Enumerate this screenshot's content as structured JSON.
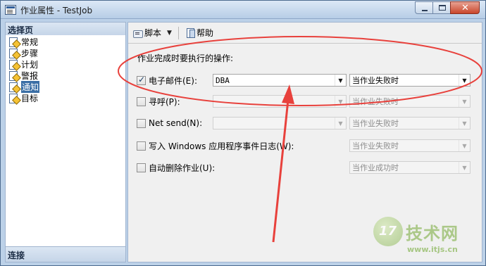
{
  "window": {
    "title": "作业属性 - TestJob",
    "minimize_glyph": "",
    "close_glyph": "✕"
  },
  "left_pane": {
    "header": "选择页",
    "items": [
      {
        "label": "常规",
        "selected": false
      },
      {
        "label": "步骤",
        "selected": false
      },
      {
        "label": "计划",
        "selected": false
      },
      {
        "label": "警报",
        "selected": false
      },
      {
        "label": "通知",
        "selected": true
      },
      {
        "label": "目标",
        "selected": false
      }
    ],
    "footer": "连接"
  },
  "toolbar": {
    "script_label": "脚本",
    "script_caret": "▼",
    "help_label": "帮助"
  },
  "notifications": {
    "section_label": "作业完成时要执行的操作:",
    "rows": [
      {
        "label": "电子邮件(E):",
        "checked": true,
        "target": "DBA",
        "target_enabled": true,
        "condition": "当作业失败时",
        "condition_enabled": true
      },
      {
        "label": "寻呼(P):",
        "checked": false,
        "target": "",
        "target_enabled": false,
        "condition": "当作业失败时",
        "condition_enabled": false
      },
      {
        "label": "Net send(N):",
        "checked": false,
        "target": "",
        "target_enabled": false,
        "condition": "当作业失败时",
        "condition_enabled": false
      },
      {
        "label": "写入 Windows 应用程序事件日志(W):",
        "checked": false,
        "condition": "当作业失败时",
        "condition_enabled": false
      },
      {
        "label": "自动删除作业(U):",
        "checked": false,
        "condition": "当作业成功时",
        "condition_enabled": false
      }
    ],
    "combo_arrow": "▼"
  },
  "annotation": {
    "color": "#e8413c"
  },
  "watermark": {
    "logo_text": "17",
    "name": "技术网",
    "url": "www.itjs.cn",
    "color": "#9fc277"
  }
}
